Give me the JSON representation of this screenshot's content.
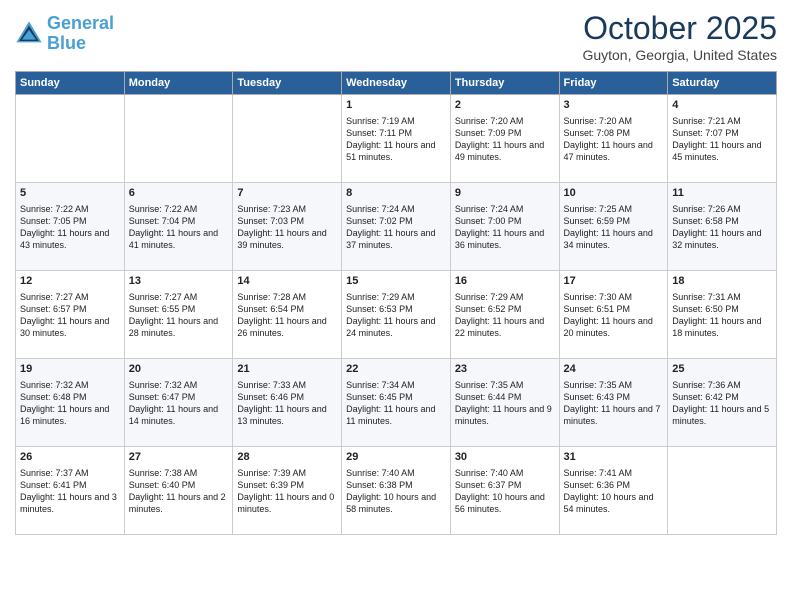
{
  "logo": {
    "line1": "General",
    "line2": "Blue"
  },
  "title": "October 2025",
  "location": "Guyton, Georgia, United States",
  "headers": [
    "Sunday",
    "Monday",
    "Tuesday",
    "Wednesday",
    "Thursday",
    "Friday",
    "Saturday"
  ],
  "rows": [
    [
      {
        "day": "",
        "sunrise": "",
        "sunset": "",
        "daylight": ""
      },
      {
        "day": "",
        "sunrise": "",
        "sunset": "",
        "daylight": ""
      },
      {
        "day": "",
        "sunrise": "",
        "sunset": "",
        "daylight": ""
      },
      {
        "day": "1",
        "sunrise": "Sunrise: 7:19 AM",
        "sunset": "Sunset: 7:11 PM",
        "daylight": "Daylight: 11 hours and 51 minutes."
      },
      {
        "day": "2",
        "sunrise": "Sunrise: 7:20 AM",
        "sunset": "Sunset: 7:09 PM",
        "daylight": "Daylight: 11 hours and 49 minutes."
      },
      {
        "day": "3",
        "sunrise": "Sunrise: 7:20 AM",
        "sunset": "Sunset: 7:08 PM",
        "daylight": "Daylight: 11 hours and 47 minutes."
      },
      {
        "day": "4",
        "sunrise": "Sunrise: 7:21 AM",
        "sunset": "Sunset: 7:07 PM",
        "daylight": "Daylight: 11 hours and 45 minutes."
      }
    ],
    [
      {
        "day": "5",
        "sunrise": "Sunrise: 7:22 AM",
        "sunset": "Sunset: 7:05 PM",
        "daylight": "Daylight: 11 hours and 43 minutes."
      },
      {
        "day": "6",
        "sunrise": "Sunrise: 7:22 AM",
        "sunset": "Sunset: 7:04 PM",
        "daylight": "Daylight: 11 hours and 41 minutes."
      },
      {
        "day": "7",
        "sunrise": "Sunrise: 7:23 AM",
        "sunset": "Sunset: 7:03 PM",
        "daylight": "Daylight: 11 hours and 39 minutes."
      },
      {
        "day": "8",
        "sunrise": "Sunrise: 7:24 AM",
        "sunset": "Sunset: 7:02 PM",
        "daylight": "Daylight: 11 hours and 37 minutes."
      },
      {
        "day": "9",
        "sunrise": "Sunrise: 7:24 AM",
        "sunset": "Sunset: 7:00 PM",
        "daylight": "Daylight: 11 hours and 36 minutes."
      },
      {
        "day": "10",
        "sunrise": "Sunrise: 7:25 AM",
        "sunset": "Sunset: 6:59 PM",
        "daylight": "Daylight: 11 hours and 34 minutes."
      },
      {
        "day": "11",
        "sunrise": "Sunrise: 7:26 AM",
        "sunset": "Sunset: 6:58 PM",
        "daylight": "Daylight: 11 hours and 32 minutes."
      }
    ],
    [
      {
        "day": "12",
        "sunrise": "Sunrise: 7:27 AM",
        "sunset": "Sunset: 6:57 PM",
        "daylight": "Daylight: 11 hours and 30 minutes."
      },
      {
        "day": "13",
        "sunrise": "Sunrise: 7:27 AM",
        "sunset": "Sunset: 6:55 PM",
        "daylight": "Daylight: 11 hours and 28 minutes."
      },
      {
        "day": "14",
        "sunrise": "Sunrise: 7:28 AM",
        "sunset": "Sunset: 6:54 PM",
        "daylight": "Daylight: 11 hours and 26 minutes."
      },
      {
        "day": "15",
        "sunrise": "Sunrise: 7:29 AM",
        "sunset": "Sunset: 6:53 PM",
        "daylight": "Daylight: 11 hours and 24 minutes."
      },
      {
        "day": "16",
        "sunrise": "Sunrise: 7:29 AM",
        "sunset": "Sunset: 6:52 PM",
        "daylight": "Daylight: 11 hours and 22 minutes."
      },
      {
        "day": "17",
        "sunrise": "Sunrise: 7:30 AM",
        "sunset": "Sunset: 6:51 PM",
        "daylight": "Daylight: 11 hours and 20 minutes."
      },
      {
        "day": "18",
        "sunrise": "Sunrise: 7:31 AM",
        "sunset": "Sunset: 6:50 PM",
        "daylight": "Daylight: 11 hours and 18 minutes."
      }
    ],
    [
      {
        "day": "19",
        "sunrise": "Sunrise: 7:32 AM",
        "sunset": "Sunset: 6:48 PM",
        "daylight": "Daylight: 11 hours and 16 minutes."
      },
      {
        "day": "20",
        "sunrise": "Sunrise: 7:32 AM",
        "sunset": "Sunset: 6:47 PM",
        "daylight": "Daylight: 11 hours and 14 minutes."
      },
      {
        "day": "21",
        "sunrise": "Sunrise: 7:33 AM",
        "sunset": "Sunset: 6:46 PM",
        "daylight": "Daylight: 11 hours and 13 minutes."
      },
      {
        "day": "22",
        "sunrise": "Sunrise: 7:34 AM",
        "sunset": "Sunset: 6:45 PM",
        "daylight": "Daylight: 11 hours and 11 minutes."
      },
      {
        "day": "23",
        "sunrise": "Sunrise: 7:35 AM",
        "sunset": "Sunset: 6:44 PM",
        "daylight": "Daylight: 11 hours and 9 minutes."
      },
      {
        "day": "24",
        "sunrise": "Sunrise: 7:35 AM",
        "sunset": "Sunset: 6:43 PM",
        "daylight": "Daylight: 11 hours and 7 minutes."
      },
      {
        "day": "25",
        "sunrise": "Sunrise: 7:36 AM",
        "sunset": "Sunset: 6:42 PM",
        "daylight": "Daylight: 11 hours and 5 minutes."
      }
    ],
    [
      {
        "day": "26",
        "sunrise": "Sunrise: 7:37 AM",
        "sunset": "Sunset: 6:41 PM",
        "daylight": "Daylight: 11 hours and 3 minutes."
      },
      {
        "day": "27",
        "sunrise": "Sunrise: 7:38 AM",
        "sunset": "Sunset: 6:40 PM",
        "daylight": "Daylight: 11 hours and 2 minutes."
      },
      {
        "day": "28",
        "sunrise": "Sunrise: 7:39 AM",
        "sunset": "Sunset: 6:39 PM",
        "daylight": "Daylight: 11 hours and 0 minutes."
      },
      {
        "day": "29",
        "sunrise": "Sunrise: 7:40 AM",
        "sunset": "Sunset: 6:38 PM",
        "daylight": "Daylight: 10 hours and 58 minutes."
      },
      {
        "day": "30",
        "sunrise": "Sunrise: 7:40 AM",
        "sunset": "Sunset: 6:37 PM",
        "daylight": "Daylight: 10 hours and 56 minutes."
      },
      {
        "day": "31",
        "sunrise": "Sunrise: 7:41 AM",
        "sunset": "Sunset: 6:36 PM",
        "daylight": "Daylight: 10 hours and 54 minutes."
      },
      {
        "day": "",
        "sunrise": "",
        "sunset": "",
        "daylight": ""
      }
    ]
  ]
}
